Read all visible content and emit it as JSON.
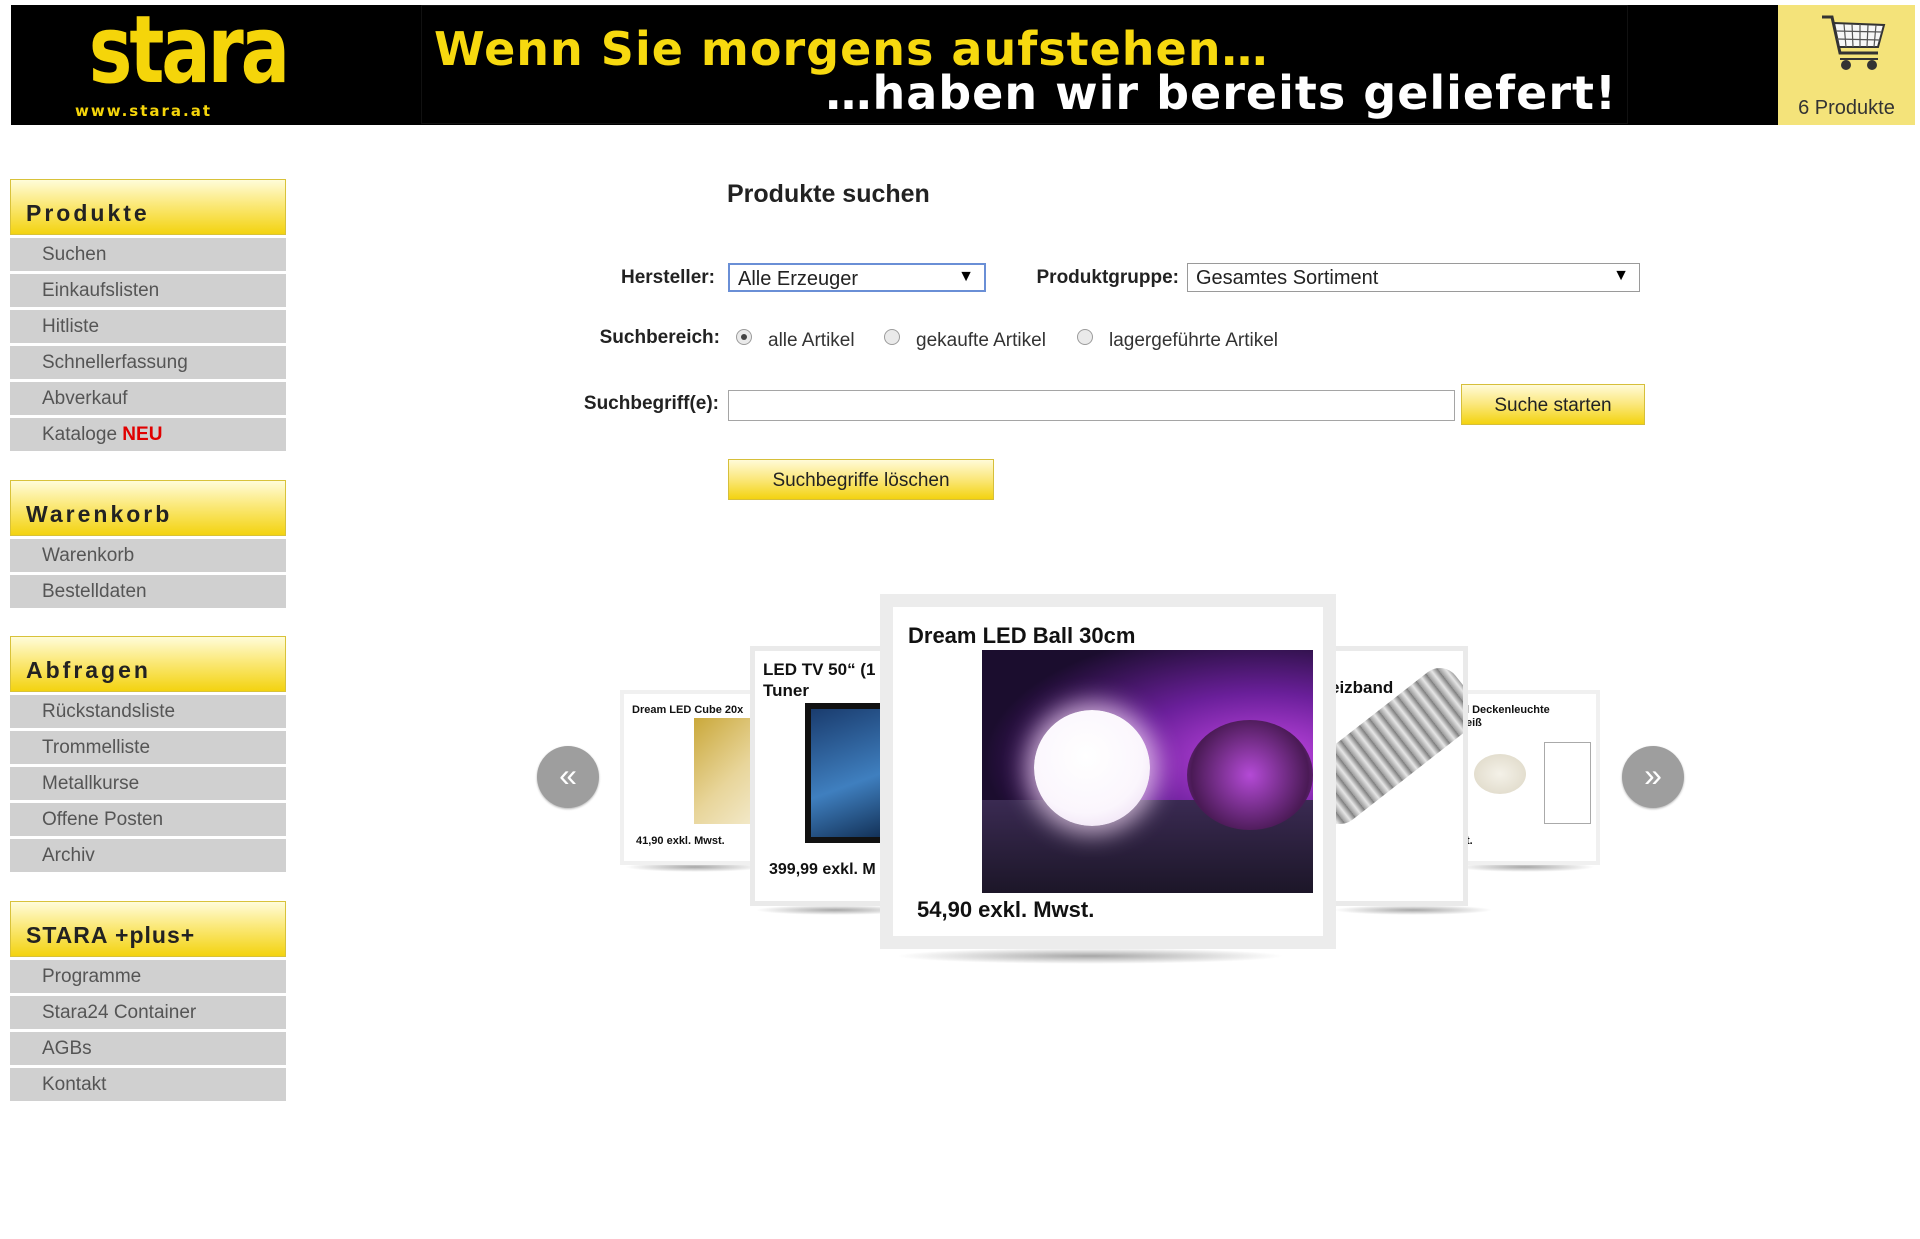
{
  "header": {
    "logo_text": "stara",
    "logo_url": "www.stara.at",
    "slogan_line1": "Wenn Sie morgens aufstehen…",
    "slogan_line2": "…haben wir bereits geliefert!",
    "cart_label": "6 Produkte"
  },
  "sidebar": {
    "groups": [
      {
        "title": "Produkte",
        "items": [
          "Suchen",
          "Einkaufslisten",
          "Hitliste",
          "Schnellerfassung",
          "Abverkauf",
          "Kataloge"
        ],
        "badge": "NEU"
      },
      {
        "title": "Warenkorb",
        "items": [
          "Warenkorb",
          "Bestelldaten"
        ]
      },
      {
        "title": "Abfragen",
        "items": [
          "Rückstandsliste",
          "Trommelliste",
          "Metallkurse",
          "Offene Posten",
          "Archiv"
        ]
      },
      {
        "title": "STARA +plus+",
        "items": [
          "Programme",
          "Stara24 Container",
          "AGBs",
          "Kontakt"
        ]
      }
    ]
  },
  "search": {
    "title": "Produkte suchen",
    "hersteller_label": "Hersteller:",
    "hersteller_value": "Alle Erzeuger",
    "produktgruppe_label": "Produktgruppe:",
    "produktgruppe_value": "Gesamtes Sortiment",
    "suchbereich_label": "Suchbereich:",
    "radios": [
      "alle Artikel",
      "gekaufte Artikel",
      "lagergeführte Artikel"
    ],
    "radio_selected": "alle Artikel",
    "suchbegriff_label": "Suchbegriff(e):",
    "suchbegriff_value": "",
    "search_button": "Suche starten",
    "clear_button": "Suchbegriffe löschen"
  },
  "carousel": {
    "prev_icon": "double-chevron-left-icon",
    "next_icon": "double-chevron-right-icon",
    "items": [
      {
        "title": "Dream LED Cube 20x",
        "price": "41,90 exkl. Mwst."
      },
      {
        "title": "LED TV 50“ (1",
        "title2": "Tuner",
        "price": "399,99 exkl. M"
      },
      {
        "title": "Dream LED Ball 30cm",
        "price": "54,90 exkl. Mwst."
      },
      {
        "title": "eizband",
        "price": ""
      },
      {
        "title": "l Deckenleuchte",
        "title2": "eiß",
        "price": "t."
      }
    ]
  },
  "colors": {
    "brand_yellow": "#f3d310",
    "header_black": "#000000",
    "nav_item_gray": "#d0d0d0",
    "new_red": "#e00000"
  }
}
